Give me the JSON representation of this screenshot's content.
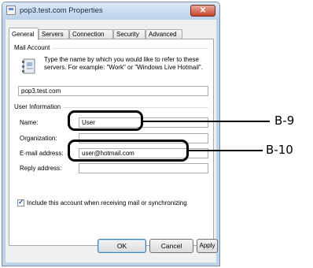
{
  "window": {
    "title": "pop3.test.com Properties",
    "close_glyph": "✕"
  },
  "tabs": [
    "General",
    "Servers",
    "Connection",
    "Security",
    "Advanced"
  ],
  "mail_account": {
    "group_label": "Mail Account",
    "description": "Type the name by which you would like to refer to these servers.  For example: \"Work\" or \"Windows Live Hotmail\".",
    "account_name": "pop3.test.com"
  },
  "user_info": {
    "group_label": "User Information",
    "name_label": "Name:",
    "name_value": "User",
    "organization_label": "Organization:",
    "organization_value": "",
    "email_label": "E-mail address:",
    "email_value": "user@hotmail.com",
    "reply_label": "Reply address:",
    "reply_value": ""
  },
  "include_checkbox": {
    "label": "Include this account when receiving mail or synchronizing",
    "checked": true,
    "check_glyph": "✓"
  },
  "buttons": {
    "ok": "OK",
    "cancel": "Cancel",
    "apply": "Apply"
  },
  "callouts": {
    "b9": "B-9",
    "b10": "B-10"
  }
}
